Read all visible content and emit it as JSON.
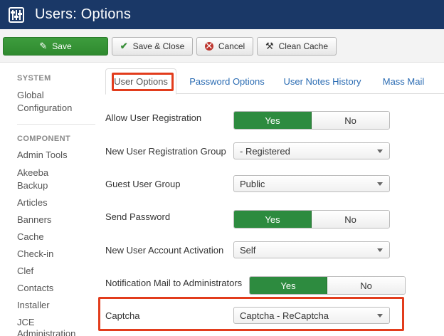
{
  "header": {
    "title": "Users: Options",
    "icon": "sliders-icon"
  },
  "toolbar": {
    "save": "Save",
    "save_close": "Save & Close",
    "cancel": "Cancel",
    "clean_cache": "Clean Cache"
  },
  "sidebar": {
    "system_heading": "SYSTEM",
    "system_items": [
      "Global",
      "Configuration"
    ],
    "component_heading": "COMPONENT",
    "items": [
      "Admin Tools",
      "Akeeba",
      "Backup",
      "Articles",
      "Banners",
      "Cache",
      "Check-in",
      "Clef",
      "Contacts",
      "Installer",
      "JCE",
      "Administration"
    ]
  },
  "tabs": [
    "User Options",
    "Password Options",
    "User Notes History",
    "Mass Mail"
  ],
  "form": {
    "allow_registration": {
      "label": "Allow User Registration",
      "yes": "Yes",
      "no": "No",
      "value": "Yes"
    },
    "registration_group": {
      "label": "New User Registration Group",
      "value": "- Registered"
    },
    "guest_group": {
      "label": "Guest User Group",
      "value": "Public"
    },
    "send_password": {
      "label": "Send Password",
      "yes": "Yes",
      "no": "No",
      "value": "Yes"
    },
    "account_activation": {
      "label": "New User Account Activation",
      "value": "Self"
    },
    "notification_mail": {
      "label": "Notification Mail to Administrators",
      "yes": "Yes",
      "no": "No",
      "value": "Yes"
    },
    "captcha": {
      "label": "Captcha",
      "value": "Captcha - ReCaptcha"
    }
  },
  "colors": {
    "header_bg": "#1a3867",
    "accent_green": "#2d8b3f",
    "highlight_red": "#e23c1c",
    "link_blue": "#2b6cb3"
  }
}
